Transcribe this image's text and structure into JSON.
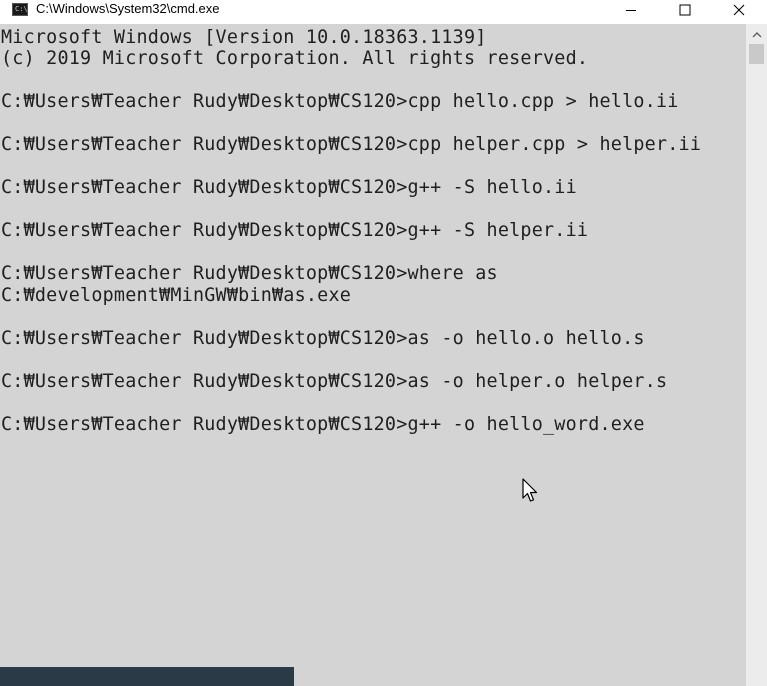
{
  "window": {
    "title": "C:\\Windows\\System32\\cmd.exe",
    "icon": "cmd-app-icon",
    "icon_text": "C:\\",
    "controls": [
      "minimize-icon",
      "maximize-icon",
      "close-icon"
    ]
  },
  "console": {
    "lines": [
      "Microsoft Windows [Version 10.0.18363.1139]",
      "(c) 2019 Microsoft Corporation. All rights reserved.",
      "",
      "C:₩Users₩Teacher Rudy₩Desktop₩CS120>cpp hello.cpp > hello.ii",
      "",
      "C:₩Users₩Teacher Rudy₩Desktop₩CS120>cpp helper.cpp > helper.ii",
      "",
      "C:₩Users₩Teacher Rudy₩Desktop₩CS120>g++ -S hello.ii",
      "",
      "C:₩Users₩Teacher Rudy₩Desktop₩CS120>g++ -S helper.ii",
      "",
      "C:₩Users₩Teacher Rudy₩Desktop₩CS120>where as",
      "C:₩development₩MinGW₩bin₩as.exe",
      "",
      "C:₩Users₩Teacher Rudy₩Desktop₩CS120>as -o hello.o hello.s",
      "",
      "C:₩Users₩Teacher Rudy₩Desktop₩CS120>as -o helper.o helper.s",
      "",
      "C:₩Users₩Teacher Rudy₩Desktop₩CS120>g++ -o hello_word.exe"
    ]
  },
  "colors": {
    "console_bg": "#d4d4d4",
    "console_text": "#1f1f1f",
    "titlebar_bg": "#ffffff"
  }
}
